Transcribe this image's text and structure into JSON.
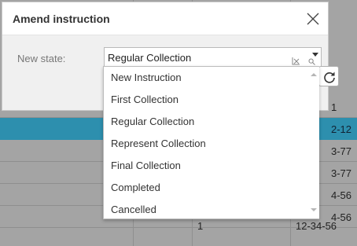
{
  "background_grid": {
    "rows": [
      {
        "c1": "",
        "c2": "",
        "c3": "1",
        "selected": false
      },
      {
        "c1": "",
        "c2": "",
        "c3": "2-12",
        "selected": true
      },
      {
        "c1": "",
        "c2": "",
        "c3": "3-77",
        "selected": false
      },
      {
        "c1": "",
        "c2": "",
        "c3": "3-77",
        "selected": false
      },
      {
        "c1": "",
        "c2": "",
        "c3": "4-56",
        "selected": false
      },
      {
        "c1": "",
        "c2": "",
        "c3": "4-56",
        "selected": false
      },
      {
        "c1": "",
        "c2": "1",
        "c3": "12-34-56",
        "selected": false
      }
    ],
    "selected_row_color": "#2d8fae"
  },
  "modal": {
    "title": "Amend instruction",
    "close_icon": "close-icon",
    "field_label": "New state:",
    "select": {
      "value": "Regular Collection",
      "clear_icon": "clear-icon",
      "search_icon": "search-icon",
      "arrow_icon": "chevron-down-icon"
    },
    "refresh_icon": "refresh-icon",
    "options": [
      "New Instruction",
      "First Collection",
      "Regular Collection",
      "Represent Collection",
      "Final Collection",
      "Completed",
      "Cancelled"
    ]
  }
}
